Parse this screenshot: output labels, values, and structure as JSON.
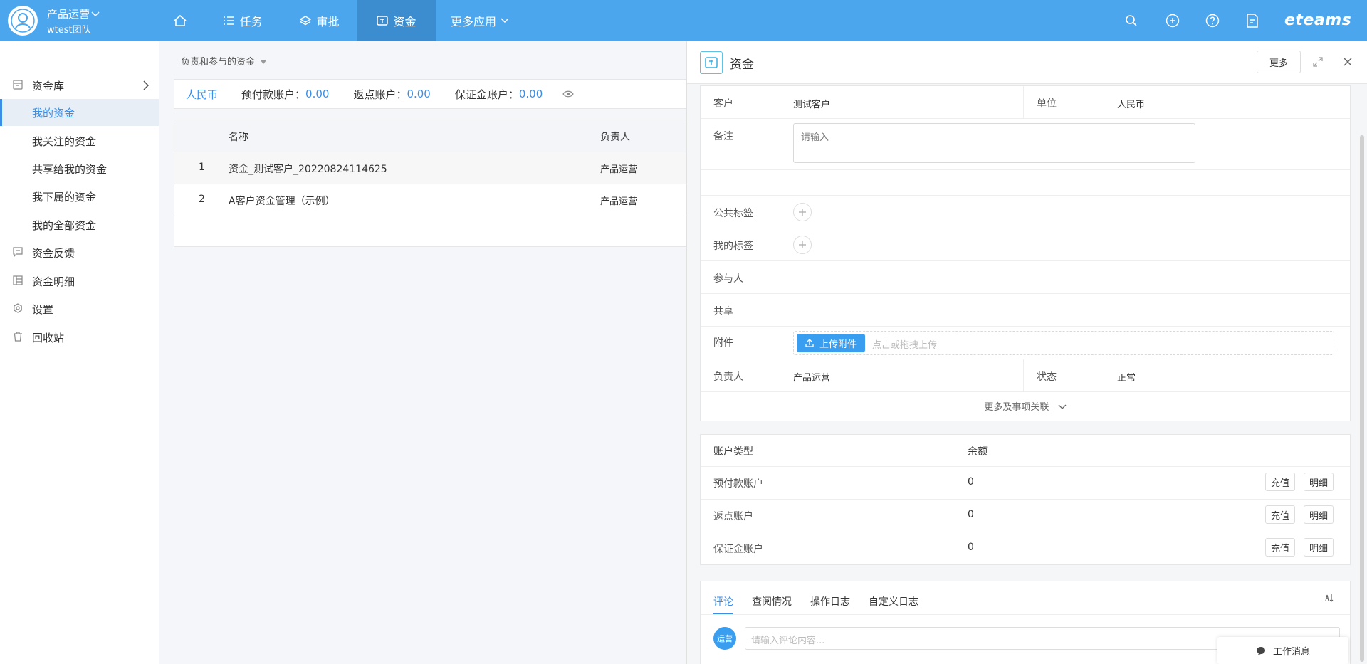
{
  "header": {
    "user_name": "产品运营",
    "team_name": "wtest团队",
    "nav": [
      {
        "label": ""
      },
      {
        "label": "任务"
      },
      {
        "label": "审批"
      },
      {
        "label": "资金"
      },
      {
        "label": "更多应用"
      }
    ],
    "logo": "eteams",
    "icons": [
      "search-icon",
      "add-icon",
      "help-icon",
      "document-icon"
    ]
  },
  "sidebar": {
    "items": [
      {
        "label": "资金库",
        "icon": "archive-icon"
      },
      {
        "label": "我的资金"
      },
      {
        "label": "我关注的资金"
      },
      {
        "label": "共享给我的资金"
      },
      {
        "label": "我下属的资金"
      },
      {
        "label": "我的全部资金"
      },
      {
        "label": "资金反馈",
        "icon": "feedback-icon"
      },
      {
        "label": "资金明细",
        "icon": "table-icon"
      },
      {
        "label": "设置",
        "icon": "settings-icon"
      },
      {
        "label": "回收站",
        "icon": "trash-icon"
      }
    ],
    "active_index": 1
  },
  "list": {
    "filter_label": "负责和参与的资金",
    "currency": "人民币",
    "accounts": [
      {
        "label": "预付款账户：",
        "value": "0.00"
      },
      {
        "label": "返点账户：",
        "value": "0.00"
      },
      {
        "label": "保证金账户：",
        "value": "0.00"
      }
    ],
    "columns": {
      "name": "名称",
      "owner": "负责人"
    },
    "rows": [
      {
        "index": "1",
        "name": "资金_测试客户_20220824114625",
        "owner": "产品运营"
      },
      {
        "index": "2",
        "name": "A客户资金管理（示例）",
        "owner": "产品运营"
      }
    ]
  },
  "detail": {
    "title": "资金",
    "more_button": "更多",
    "fields": {
      "customer_label": "客户",
      "customer_value": "测试客户",
      "unit_label": "单位",
      "unit_value": "人民币",
      "remark_label": "备注",
      "remark_placeholder": "请输入",
      "public_tags_label": "公共标签",
      "my_tags_label": "我的标签",
      "participants_label": "参与人",
      "share_label": "共享",
      "attachment_label": "附件",
      "upload_button": "上传附件",
      "upload_hint": "点击或拖拽上传",
      "owner_label": "负责人",
      "owner_value": "产品运营",
      "status_label": "状态",
      "status_value": "正常",
      "more_relations": "更多及事项关联"
    },
    "balance": {
      "header_type": "账户类型",
      "header_balance": "余额",
      "rows": [
        {
          "type": "预付款账户",
          "balance": "0",
          "recharge": "充值",
          "detail": "明细"
        },
        {
          "type": "返点账户",
          "balance": "0",
          "recharge": "充值",
          "detail": "明细"
        },
        {
          "type": "保证金账户",
          "balance": "0",
          "recharge": "充值",
          "detail": "明细"
        }
      ]
    },
    "tabs": [
      {
        "label": "评论"
      },
      {
        "label": "查阅情况"
      },
      {
        "label": "操作日志"
      },
      {
        "label": "自定义日志"
      }
    ],
    "comment_avatar": "运营",
    "comment_placeholder": "请输入评论内容..."
  },
  "work_message": "工作消息",
  "colors": {
    "primary": "#4ba6ee",
    "link": "#3a8ee6",
    "active_nav": "#3b8dd0"
  }
}
